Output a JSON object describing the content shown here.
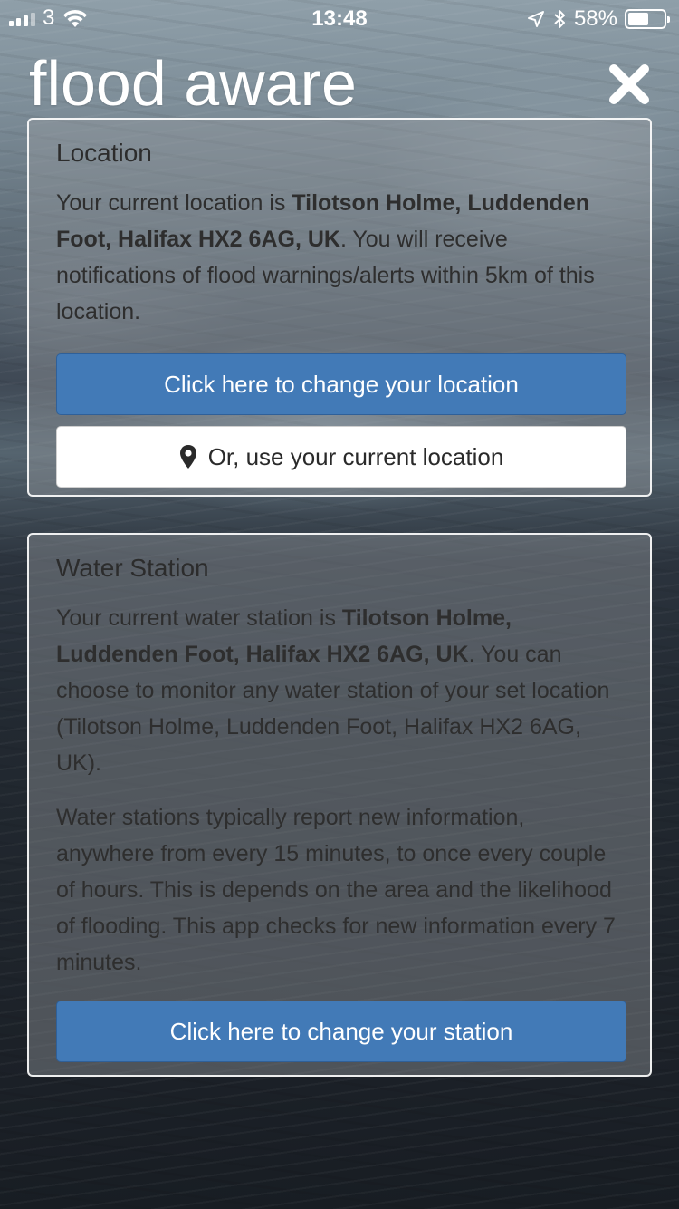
{
  "status_bar": {
    "carrier": "3",
    "time": "13:48",
    "battery_text": "58%",
    "battery_level": 0.58,
    "icons": [
      "signal-icon",
      "wifi-icon",
      "location-arrow-icon",
      "bluetooth-icon",
      "battery-icon"
    ]
  },
  "header": {
    "title": "flood aware",
    "close_icon": "close-icon"
  },
  "location_panel": {
    "heading": "Location",
    "text_prefix": "Your current location is ",
    "location_bold": "Tilotson Holme, Luddenden Foot, Halifax HX2 6AG, UK",
    "text_suffix": ". You will receive notifications of flood warnings/alerts within 5km of this location.",
    "change_button": "Click here to change your location",
    "current_button": "Or, use your current location",
    "current_button_icon": "map-pin-icon"
  },
  "station_panel": {
    "heading": "Water Station",
    "text_prefix": "Your current water station is ",
    "station_bold": "Tilotson Holme, Luddenden Foot, Halifax HX2 6AG, UK",
    "text_suffix": ". You can choose to monitor any water station of your set location (Tilotson Holme, Luddenden Foot, Halifax HX2 6AG, UK).",
    "info_text": "Water stations typically report new information, anywhere from every 15 minutes, to once every couple of hours. This is depends on the area and the likelihood of flooding. This app checks for new information every 7 minutes.",
    "change_button": "Click here to change your station"
  },
  "colors": {
    "primary_button": "#427ab7",
    "panel_border": "#ffffff",
    "title_text": "#ffffff"
  }
}
